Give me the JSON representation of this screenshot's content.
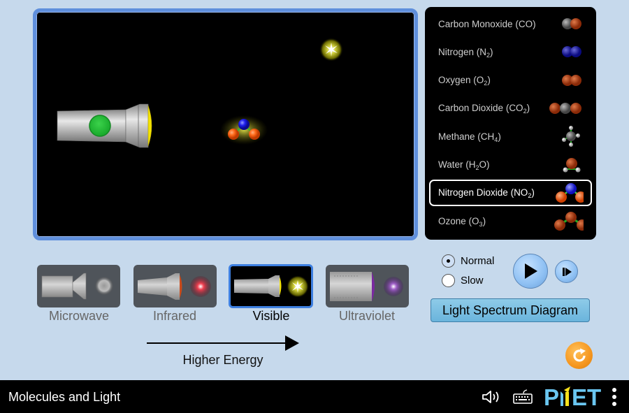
{
  "molecules": [
    {
      "name": "Carbon Monoxide",
      "formula_main": "CO",
      "formula_sub": "",
      "formula_tail": "",
      "selected": false
    },
    {
      "name": "Nitrogen",
      "formula_main": "N",
      "formula_sub": "2",
      "formula_tail": "",
      "selected": false
    },
    {
      "name": "Oxygen",
      "formula_main": "O",
      "formula_sub": "2",
      "formula_tail": "",
      "selected": false
    },
    {
      "name": "Carbon Dioxide",
      "formula_main": "CO",
      "formula_sub": "2",
      "formula_tail": "",
      "selected": false
    },
    {
      "name": "Methane",
      "formula_main": "CH",
      "formula_sub": "4",
      "formula_tail": "",
      "selected": false
    },
    {
      "name": "Water",
      "formula_main": "H",
      "formula_sub": "2",
      "formula_tail": "O",
      "selected": false
    },
    {
      "name": "Nitrogen Dioxide",
      "formula_main": "NO",
      "formula_sub": "2",
      "formula_tail": "",
      "selected": true
    },
    {
      "name": "Ozone",
      "formula_main": "O",
      "formula_sub": "3",
      "formula_tail": "",
      "selected": false
    }
  ],
  "light_sources": [
    {
      "label": "Microwave",
      "selected": false,
      "icon": "microwave-emitter-icon"
    },
    {
      "label": "Infrared",
      "selected": false,
      "icon": "infrared-lamp-icon"
    },
    {
      "label": "Visible",
      "selected": true,
      "icon": "flashlight-icon"
    },
    {
      "label": "Ultraviolet",
      "selected": false,
      "icon": "uv-lamp-icon"
    }
  ],
  "energy_label": "Higher Energy",
  "speed": {
    "options": [
      {
        "label": "Normal",
        "checked": true
      },
      {
        "label": "Slow",
        "checked": false
      }
    ]
  },
  "spectrum_button_label": "Light Spectrum Diagram",
  "play_state": "paused",
  "navbar": {
    "title": "Molecules and Light",
    "brand": "PhET"
  },
  "colors": {
    "play_area_border": "#5f8fdc",
    "background": "#c6d9ec",
    "selected_source_border": "#3d7fe0",
    "reset_orange": "#f5961e",
    "phet_blue": "#6ac6f0",
    "phet_yellow": "#f8e11c"
  }
}
